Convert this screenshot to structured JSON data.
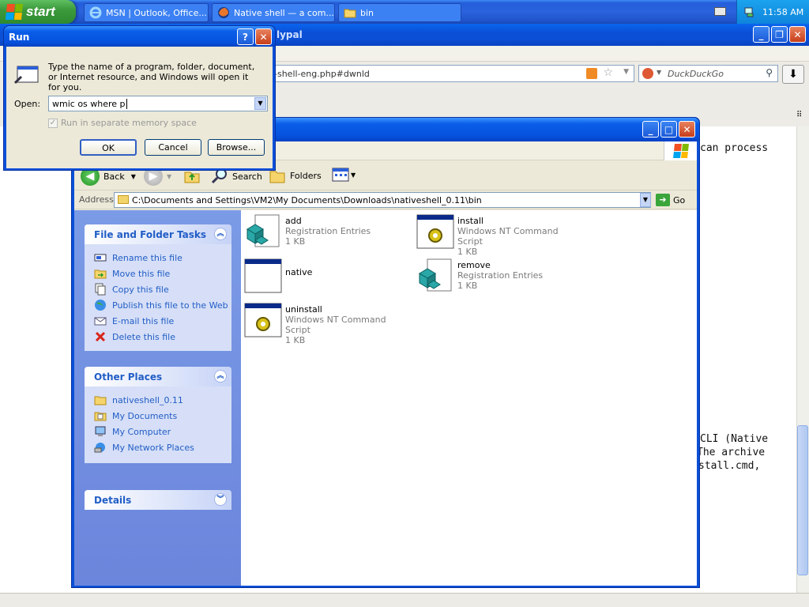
{
  "taskbar": {
    "start_label": "start",
    "tasks": [
      {
        "label": "MSN | Outlook, Office...",
        "icon": "ie-icon"
      },
      {
        "label": "Native shell — a com...",
        "icon": "firefox-icon"
      },
      {
        "label": "bin",
        "icon": "folder-icon"
      }
    ],
    "clock": "11:58 AM"
  },
  "browser": {
    "title_fragment": "lypal",
    "url_fragment": "-shell-eng.php#dwnld",
    "search_placeholder": "DuckDuckGo",
    "page_text": {
      "line1": "can process",
      "line2": "CLI (Native",
      "line3": "The archive",
      "line4": "stall.cmd,"
    }
  },
  "explorer": {
    "toolbar": {
      "back": "Back",
      "search": "Search",
      "folders": "Folders"
    },
    "address": {
      "label": "Address",
      "path": "C:\\Documents and Settings\\VM2\\My Documents\\Downloads\\nativeshell_0.11\\bin",
      "go": "Go"
    },
    "tasks_panel": {
      "title": "File and Folder Tasks",
      "items": [
        {
          "label": "Rename this file",
          "icon": "rename-icon"
        },
        {
          "label": "Move this file",
          "icon": "move-icon"
        },
        {
          "label": "Copy this file",
          "icon": "copy-icon"
        },
        {
          "label": "Publish this file to the Web",
          "icon": "globe-icon"
        },
        {
          "label": "E-mail this file",
          "icon": "email-icon"
        },
        {
          "label": "Delete this file",
          "icon": "delete-icon"
        }
      ]
    },
    "places_panel": {
      "title": "Other Places",
      "items": [
        {
          "label": "nativeshell_0.11",
          "icon": "folder-icon"
        },
        {
          "label": "My Documents",
          "icon": "my-documents-icon"
        },
        {
          "label": "My Computer",
          "icon": "my-computer-icon"
        },
        {
          "label": "My Network Places",
          "icon": "network-icon"
        }
      ]
    },
    "details_panel": {
      "title": "Details"
    },
    "files": [
      {
        "name": "add",
        "type": "Registration Entries",
        "size": "1 KB",
        "icon": "registry-icon"
      },
      {
        "name": "install",
        "type": "Windows NT Command Script",
        "size": "1 KB",
        "icon": "cmd-script-icon"
      },
      {
        "name": "native",
        "type": "",
        "size": "",
        "icon": "window-app-icon"
      },
      {
        "name": "remove",
        "type": "Registration Entries",
        "size": "1 KB",
        "icon": "registry-icon"
      },
      {
        "name": "uninstall",
        "type": "Windows NT Command Script",
        "size": "1 KB",
        "icon": "cmd-script-icon"
      }
    ]
  },
  "run_dialog": {
    "title": "Run",
    "description": "Type the name of a program, folder, document, or Internet resource, and Windows will open it for you.",
    "open_label": "Open:",
    "open_value": "wmic os where p",
    "checkbox_label": "Run in separate memory space",
    "ok": "OK",
    "cancel": "Cancel",
    "browse": "Browse..."
  },
  "colors": {
    "xp_blue": "#0a50d8",
    "link_blue": "#215dc6",
    "start_green": "#3c9a3c"
  }
}
